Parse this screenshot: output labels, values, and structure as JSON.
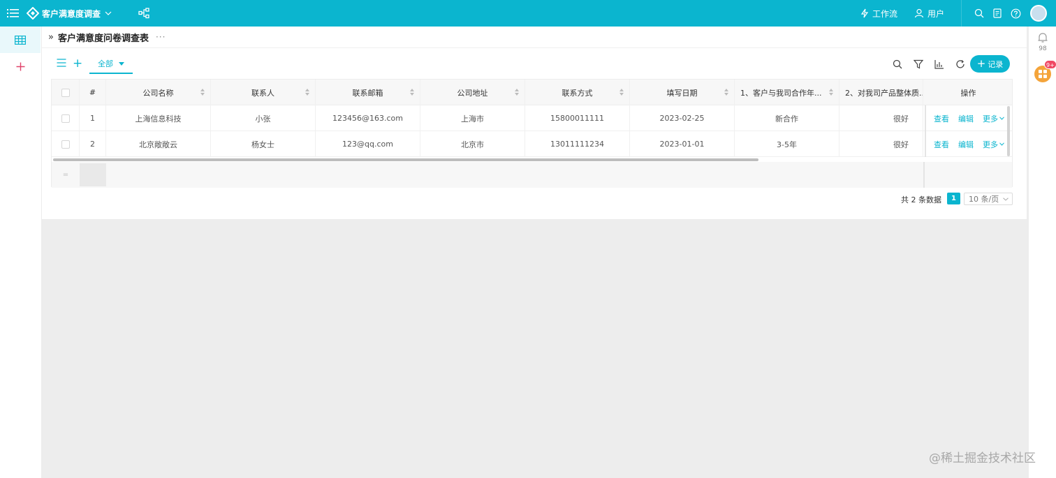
{
  "app": {
    "title": "客户满意度调查",
    "workflow_label": "工作流",
    "users_label": "用户"
  },
  "page": {
    "title": "客户满意度问卷调查表",
    "more": "···"
  },
  "toolbar": {
    "view_label": "全部",
    "add_record_label": "记录"
  },
  "table": {
    "columns": [
      "#",
      "公司名称",
      "联系人",
      "联系邮箱",
      "公司地址",
      "联系方式",
      "填写日期",
      "1、客户与我司合作年...",
      "2、对我司产品整体质...",
      "操作"
    ],
    "rows": [
      {
        "index": "1",
        "company": "上海信息科技",
        "contact": "小张",
        "email": "123456@163.com",
        "address": "上海市",
        "phone": "15800011111",
        "date": "2023-02-25",
        "q1": "新合作",
        "q2": "很好"
      },
      {
        "index": "2",
        "company": "北京敞敞云",
        "contact": "杨女士",
        "email": "123@qq.com",
        "address": "北京市",
        "phone": "13011111234",
        "date": "2023-01-01",
        "q1": "3-5年",
        "q2": "很好"
      }
    ],
    "actions": {
      "view": "查看",
      "edit": "编辑",
      "more": "更多"
    },
    "footer_marker": "="
  },
  "pagination": {
    "total_text": "共 2 条数据",
    "current_page": "1",
    "page_size": "10 条/页"
  },
  "notifications": {
    "bell_count": "98",
    "apps_badge": "9+"
  },
  "watermark": "@稀土掘金技术社区",
  "colors": {
    "accent": "#0bb5cf",
    "badge": "#f04864",
    "apps": "#f4a43a"
  }
}
